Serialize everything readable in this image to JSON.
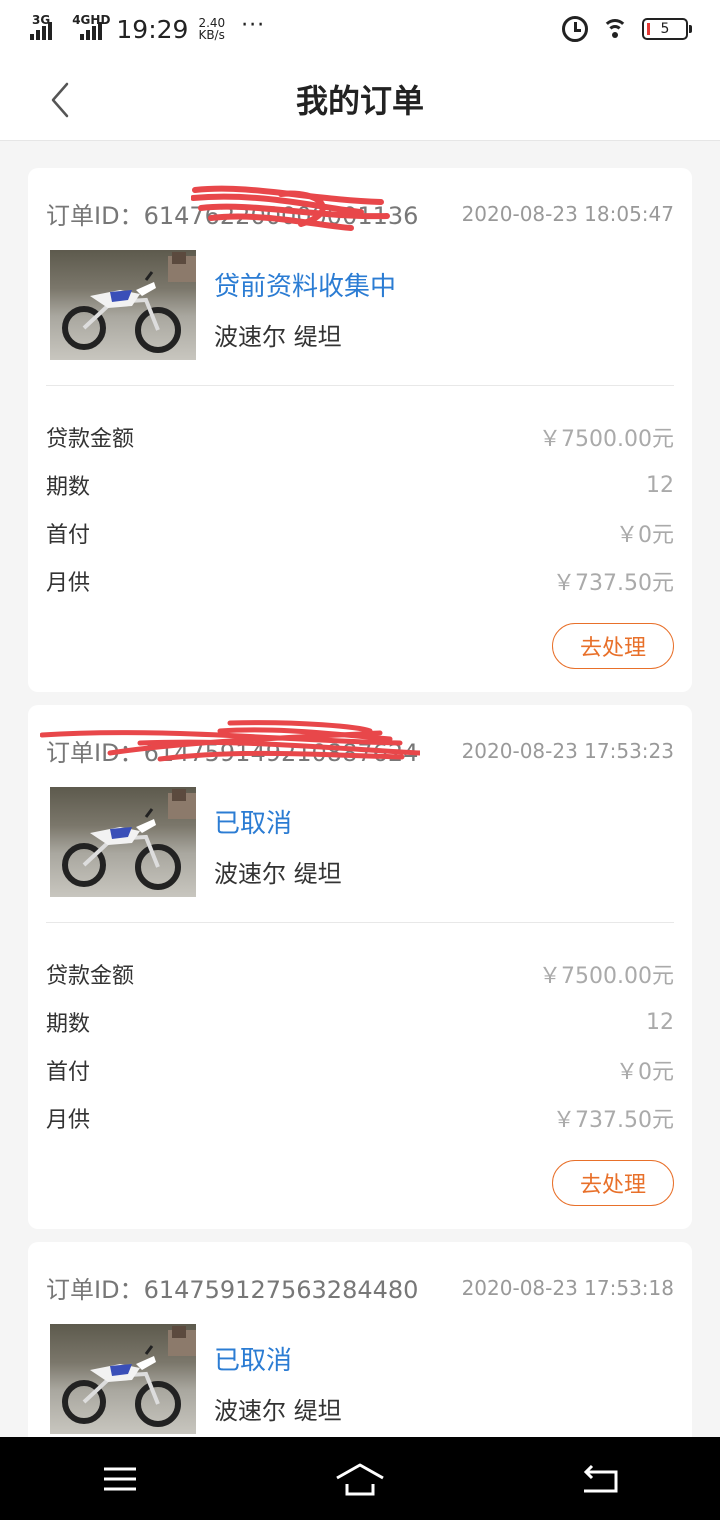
{
  "status_bar": {
    "network_1": "3G",
    "network_2": "4GHD",
    "time": "19:29",
    "speed_value": "2.40",
    "speed_unit": "KB/s",
    "more": "···",
    "battery": "5"
  },
  "nav": {
    "title": "我的订单"
  },
  "orders": [
    {
      "id_label": "订单ID：",
      "id_value": "614762200000001136",
      "time": "2020-08-23 18:05:47",
      "status": "贷前资料收集中",
      "product": "波速尔 缇坦",
      "rows": [
        {
          "key": "贷款金额",
          "value": "￥7500.00元"
        },
        {
          "key": "期数",
          "value": "12"
        },
        {
          "key": "首付",
          "value": "￥0元"
        },
        {
          "key": "月供",
          "value": "￥737.50元"
        }
      ],
      "action": "去处理"
    },
    {
      "id_label": "订单ID：",
      "id_value": "614759149210887624",
      "time": "2020-08-23 17:53:23",
      "status": "已取消",
      "product": "波速尔 缇坦",
      "rows": [
        {
          "key": "贷款金额",
          "value": "￥7500.00元"
        },
        {
          "key": "期数",
          "value": "12"
        },
        {
          "key": "首付",
          "value": "￥0元"
        },
        {
          "key": "月供",
          "value": "￥737.50元"
        }
      ],
      "action": "去处理"
    },
    {
      "id_label": "订单ID：",
      "id_value": "614759127563284480",
      "time": "2020-08-23 17:53:18",
      "status": "已取消",
      "product": "波速尔 缇坦"
    }
  ],
  "colors": {
    "accent_blue": "#2b7cd3",
    "action_orange": "#e8702a",
    "redaction_red": "#e8474a"
  }
}
